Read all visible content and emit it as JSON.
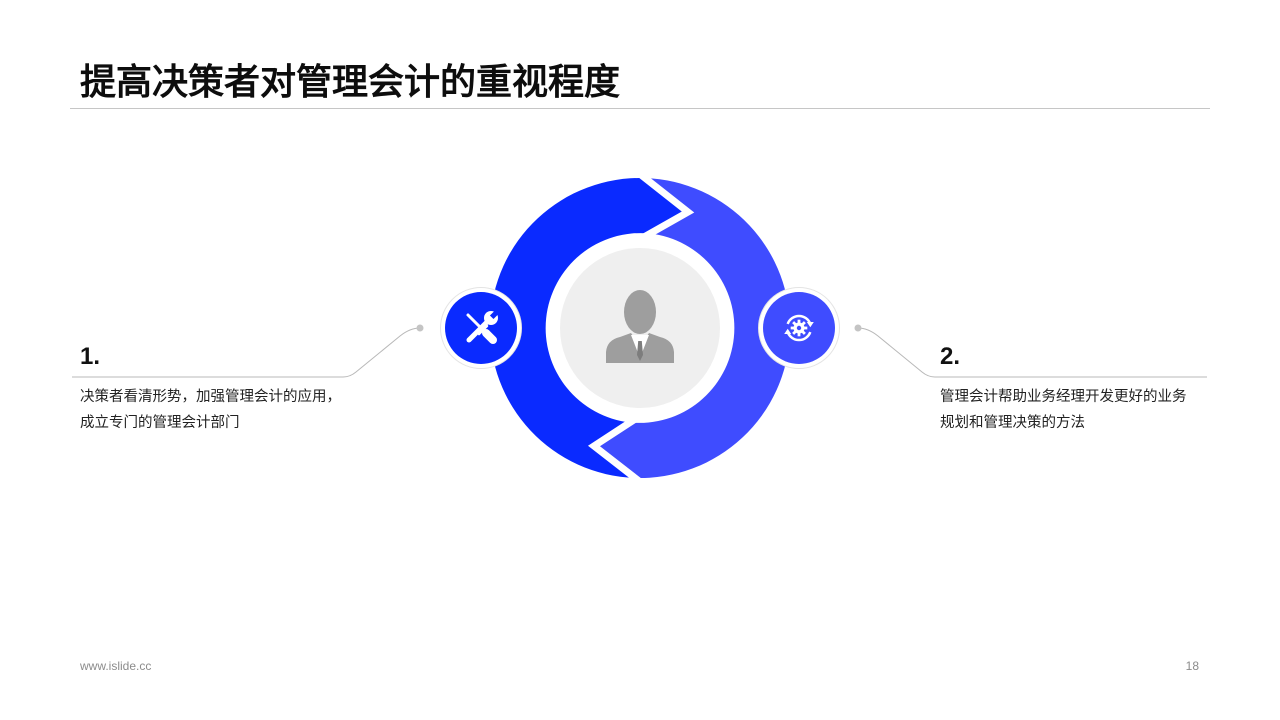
{
  "slide": {
    "title": "提高决策者对管理会计的重视程度",
    "footer_url": "www.islide.cc",
    "page_number": "18"
  },
  "colors": {
    "primary_blue": "#0a2aff",
    "secondary_blue": "#3f4cff",
    "center_gray": "#efefef",
    "person_gray": "#9e9e9e",
    "connector_gray": "#b8b8b8",
    "muted_text": "#8c8c8c"
  },
  "diagram": {
    "center_icon": "user-icon",
    "items": [
      {
        "number": "1.",
        "icon": "tools-icon",
        "lines": [
          "决策者看清形势，加强管理会计的应用，",
          "成立专门的管理会计部门"
        ]
      },
      {
        "number": "2.",
        "icon": "gear-refresh-icon",
        "lines": [
          "管理会计帮助业务经理开发更好的业务",
          "规划和管理决策的方法"
        ]
      }
    ]
  }
}
